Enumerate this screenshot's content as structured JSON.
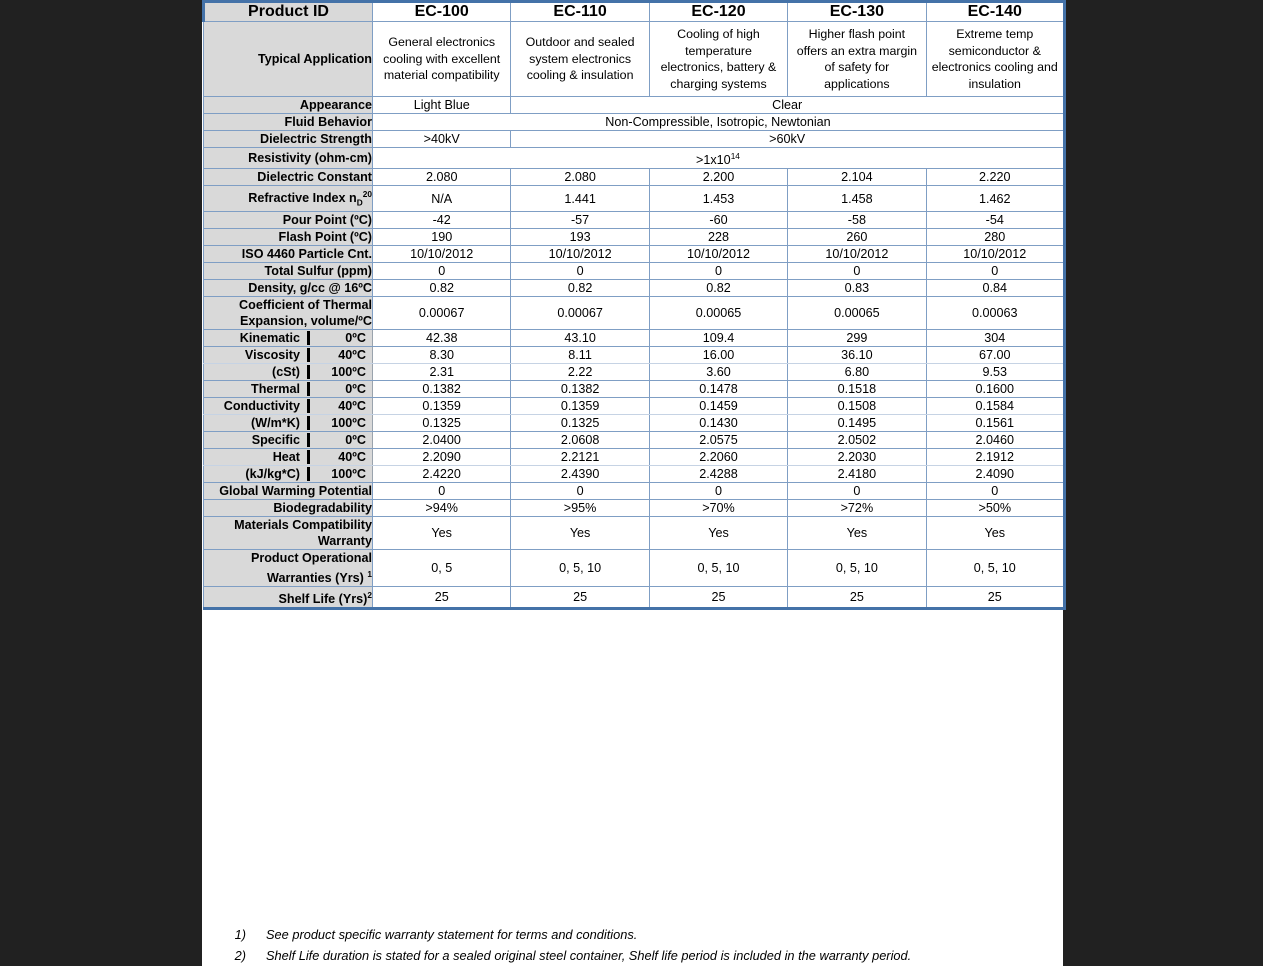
{
  "table": {
    "products": [
      "EC-100",
      "EC-110",
      "EC-120",
      "EC-130",
      "EC-140"
    ],
    "header_label": "Product ID",
    "rows": [
      {
        "label": "Typical Application",
        "values": [
          "General electronics cooling with excellent material compatibility",
          "Outdoor and sealed system electronics cooling & insulation",
          "Cooling of high temperature electronics, battery & charging systems",
          "Higher flash point offers an extra margin of safety for applications",
          "Extreme temp semiconductor & electronics cooling and insulation"
        ]
      },
      {
        "label": "Appearance",
        "values": [
          "Light Blue",
          "Clear"
        ]
      },
      {
        "label": "Fluid Behavior",
        "values": [
          "Non-Compressible, Isotropic, Newtonian"
        ]
      },
      {
        "label": "Dielectric Strength",
        "values": [
          ">40kV",
          ">60kV"
        ]
      },
      {
        "label": "Resistivity (ohm-cm)",
        "values": [
          ">1x10",
          "14"
        ]
      },
      {
        "label": "Dielectric Constant",
        "values": [
          "2.080",
          "2.080",
          "2.200",
          "2.104",
          "2.220"
        ]
      },
      {
        "label": "Refractive Index n",
        "label_sub": "D",
        "label_sup": "20",
        "values": [
          "N/A",
          "1.441",
          "1.453",
          "1.458",
          "1.462"
        ]
      },
      {
        "label": "Pour Point (ºC)",
        "values": [
          "-42",
          "-57",
          "-60",
          "-58",
          "-54"
        ]
      },
      {
        "label": "Flash Point (ºC)",
        "values": [
          "190",
          "193",
          "228",
          "260",
          "280"
        ]
      },
      {
        "label": "ISO 4460 Particle Cnt.",
        "values": [
          "10/10/2012",
          "10/10/2012",
          "10/10/2012",
          "10/10/2012",
          "10/10/2012"
        ]
      },
      {
        "label": "Total Sulfur (ppm)",
        "values": [
          "0",
          "0",
          "0",
          "0",
          "0"
        ]
      },
      {
        "label": "Density, g/cc @ 16ºC",
        "values": [
          "0.82",
          "0.82",
          "0.82",
          "0.83",
          "0.84"
        ]
      },
      {
        "label": "Coefficient of Thermal Expansion, volume/ºC",
        "values": [
          "0.00067",
          "0.00067",
          "0.00065",
          "0.00065",
          "0.00063"
        ]
      }
    ],
    "grouped": [
      {
        "group_name": [
          "Kinematic",
          "Viscosity",
          "(cSt)"
        ],
        "temps": [
          "0ºC",
          "40ºC",
          "100ºC"
        ],
        "values": [
          [
            "42.38",
            "43.10",
            "109.4",
            "299",
            "304"
          ],
          [
            "8.30",
            "8.11",
            "16.00",
            "36.10",
            "67.00"
          ],
          [
            "2.31",
            "2.22",
            "3.60",
            "6.80",
            "9.53"
          ]
        ]
      },
      {
        "group_name": [
          "Thermal",
          "Conductivity",
          "(W/m*K)"
        ],
        "temps": [
          "0ºC",
          "40ºC",
          "100ºC"
        ],
        "values": [
          [
            "0.1382",
            "0.1382",
            "0.1478",
            "0.1518",
            "0.1600"
          ],
          [
            "0.1359",
            "0.1359",
            "0.1459",
            "0.1508",
            "0.1584"
          ],
          [
            "0.1325",
            "0.1325",
            "0.1430",
            "0.1495",
            "0.1561"
          ]
        ]
      },
      {
        "group_name": [
          "Specific",
          "Heat",
          "(kJ/kg*C)"
        ],
        "temps": [
          "0ºC",
          "40ºC",
          "100ºC"
        ],
        "values": [
          [
            "2.0400",
            "2.0608",
            "2.0575",
            "2.0502",
            "2.0460"
          ],
          [
            "2.2090",
            "2.2121",
            "2.2060",
            "2.2030",
            "2.1912"
          ],
          [
            "2.4220",
            "2.4390",
            "2.4288",
            "2.4180",
            "2.4090"
          ]
        ]
      }
    ],
    "rows_tail": [
      {
        "label": "Global Warming Potential",
        "values": [
          "0",
          "0",
          "0",
          "0",
          "0"
        ]
      },
      {
        "label": "Biodegradability",
        "values": [
          ">94%",
          ">95%",
          ">70%",
          ">72%",
          ">50%"
        ]
      },
      {
        "label": "Materials Compatibility Warranty",
        "values": [
          "Yes",
          "Yes",
          "Yes",
          "Yes",
          "Yes"
        ]
      },
      {
        "label": "Product Operational Warranties (Yrs) ",
        "label_sup": "1",
        "values": [
          "0, 5",
          "0, 5, 10",
          "0, 5, 10",
          "0, 5, 10",
          "0, 5, 10"
        ]
      },
      {
        "label": "Shelf Life (Yrs)",
        "label_sup": "2",
        "values": [
          "25",
          "25",
          "25",
          "25",
          "25"
        ]
      }
    ]
  },
  "footnotes": [
    {
      "num": "1)",
      "text": "See product specific warranty statement for terms and conditions."
    },
    {
      "num": "2)",
      "text": "Shelf Life duration is stated for a sealed original steel container, Shelf life period is included in the warranty period."
    }
  ],
  "colors": {
    "border_accent": "#4472a8",
    "grid": "#7f9ec4",
    "label_bg": "#d9d9d9",
    "page_bg": "#212121"
  }
}
